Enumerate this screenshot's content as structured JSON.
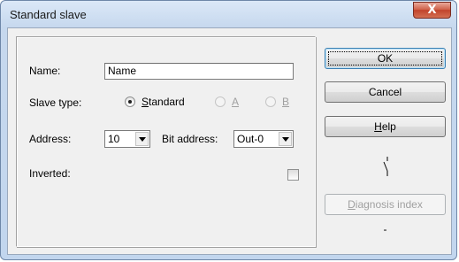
{
  "window": {
    "title": "Standard slave",
    "close_label": "X"
  },
  "form": {
    "name_label": "Name:",
    "name_value": "Name",
    "slave_type_label": "Slave type:",
    "slave_types": [
      {
        "label_pre": "",
        "label_ul": "S",
        "label_post": "tandard",
        "checked": true,
        "enabled": true
      },
      {
        "label_pre": "",
        "label_ul": "A",
        "label_post": "",
        "checked": false,
        "enabled": false
      },
      {
        "label_pre": "",
        "label_ul": "B",
        "label_post": "",
        "checked": false,
        "enabled": false
      }
    ],
    "address_label": "Address:",
    "address_value": "10",
    "bit_address_label": "Bit address:",
    "bit_address_value": "Out-0",
    "inverted_label": "Inverted:",
    "inverted_checked": false
  },
  "buttons": {
    "ok": "OK",
    "cancel": "Cancel",
    "help_ul": "H",
    "help_rest": "elp",
    "diagnosis_ul": "D",
    "diagnosis_rest": "iagnosis index"
  },
  "status": {
    "diagnosis_value": "-",
    "switch_icon": "open-contact-icon"
  }
}
